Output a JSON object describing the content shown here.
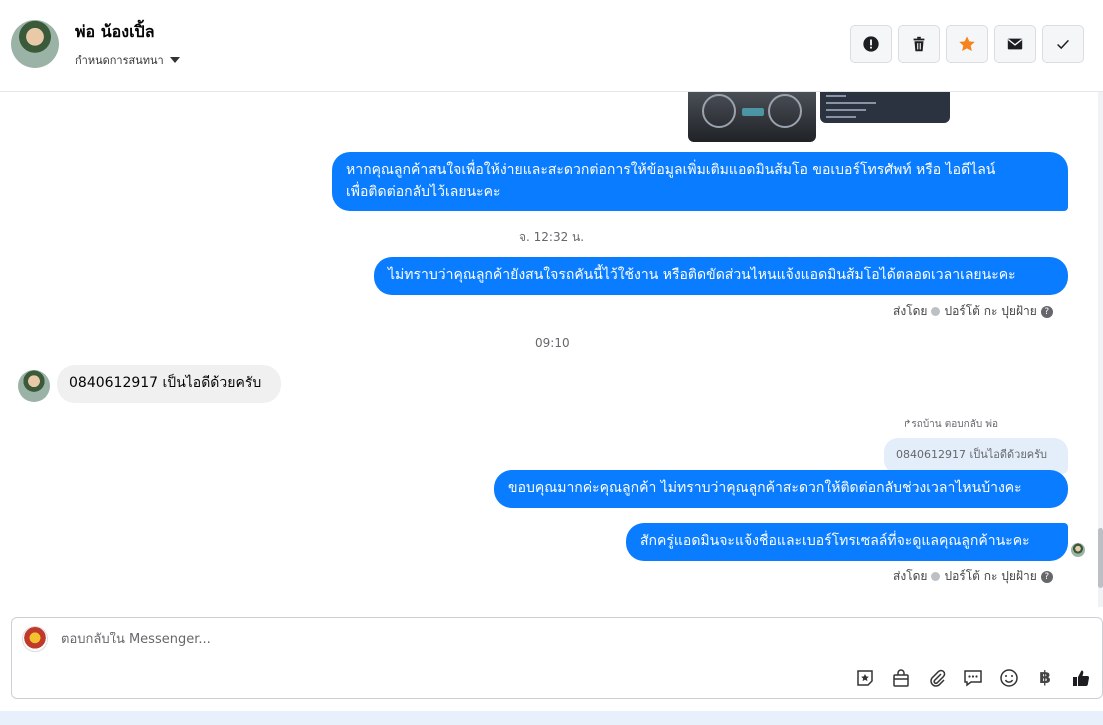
{
  "header": {
    "contact_name": "พ่อ น้องเปิ้ล",
    "assign_label": "กำหนดการสนทนา",
    "actions": [
      {
        "icon": "alert-icon"
      },
      {
        "icon": "trash-icon"
      },
      {
        "icon": "star-icon",
        "color": "#f5841f"
      },
      {
        "icon": "envelope-icon"
      },
      {
        "icon": "check-icon"
      }
    ]
  },
  "messages": {
    "out1_line1": "หากคุณลูกค้าสนใจเพื่อให้ง่ายและสะดวกต่อการให้ข้อมูลเพิ่มเติมแอดมินส้มโอ ขอเบอร์โทรศัพท์ หรือ ไอดีไลน์",
    "out1_line2": "เพื่อติดต่อกลับไว้เลยนะคะ",
    "time1": "จ. 12:32 น.",
    "out2": "ไม่ทราบว่าคุณลูกค้ายังสนใจรถคันนี้ไว้ใช้งาน หรือติดขัดส่วนไหนแจ้งแอดมินส้มโอได้ตลอดเวลาเลยนะคะ",
    "sent_by_label": "ส่งโดย",
    "sent_by_name": "ปอร์โต้ กะ ปุยฝ้าย",
    "time2": "09:10",
    "in1": "0840612917 เป็นไอดีด้วยครับ",
    "reply_label": "รถบ้าน ตอบกลับ พ่อ",
    "quoted": "0840612917 เป็นไอดีด้วยครับ",
    "out3": "ขอบคุณมากค่ะคุณลูกค้า ไม่ทราบว่าคุณลูกค้าสะดวกให้ติดต่อกลับช่วงเวลาไหนบ้างคะ",
    "out4": "สักครู่แอดมินจะแจ้งชื่อและเบอร์โทรเซลล์ที่จะดูแลคุณลูกค้านะคะ"
  },
  "composer": {
    "placeholder": "ตอบกลับใน Messenger...",
    "tools": [
      "sticker-star-icon",
      "bag-icon",
      "paperclip-icon",
      "chat-bubble-icon",
      "smiley-icon",
      "baht-icon",
      "thumbs-up-icon"
    ],
    "baht_symbol": "฿"
  },
  "colors": {
    "bubble_out": "#0a7cff",
    "bubble_in": "#f0f0f0",
    "accent_star": "#f5841f"
  }
}
